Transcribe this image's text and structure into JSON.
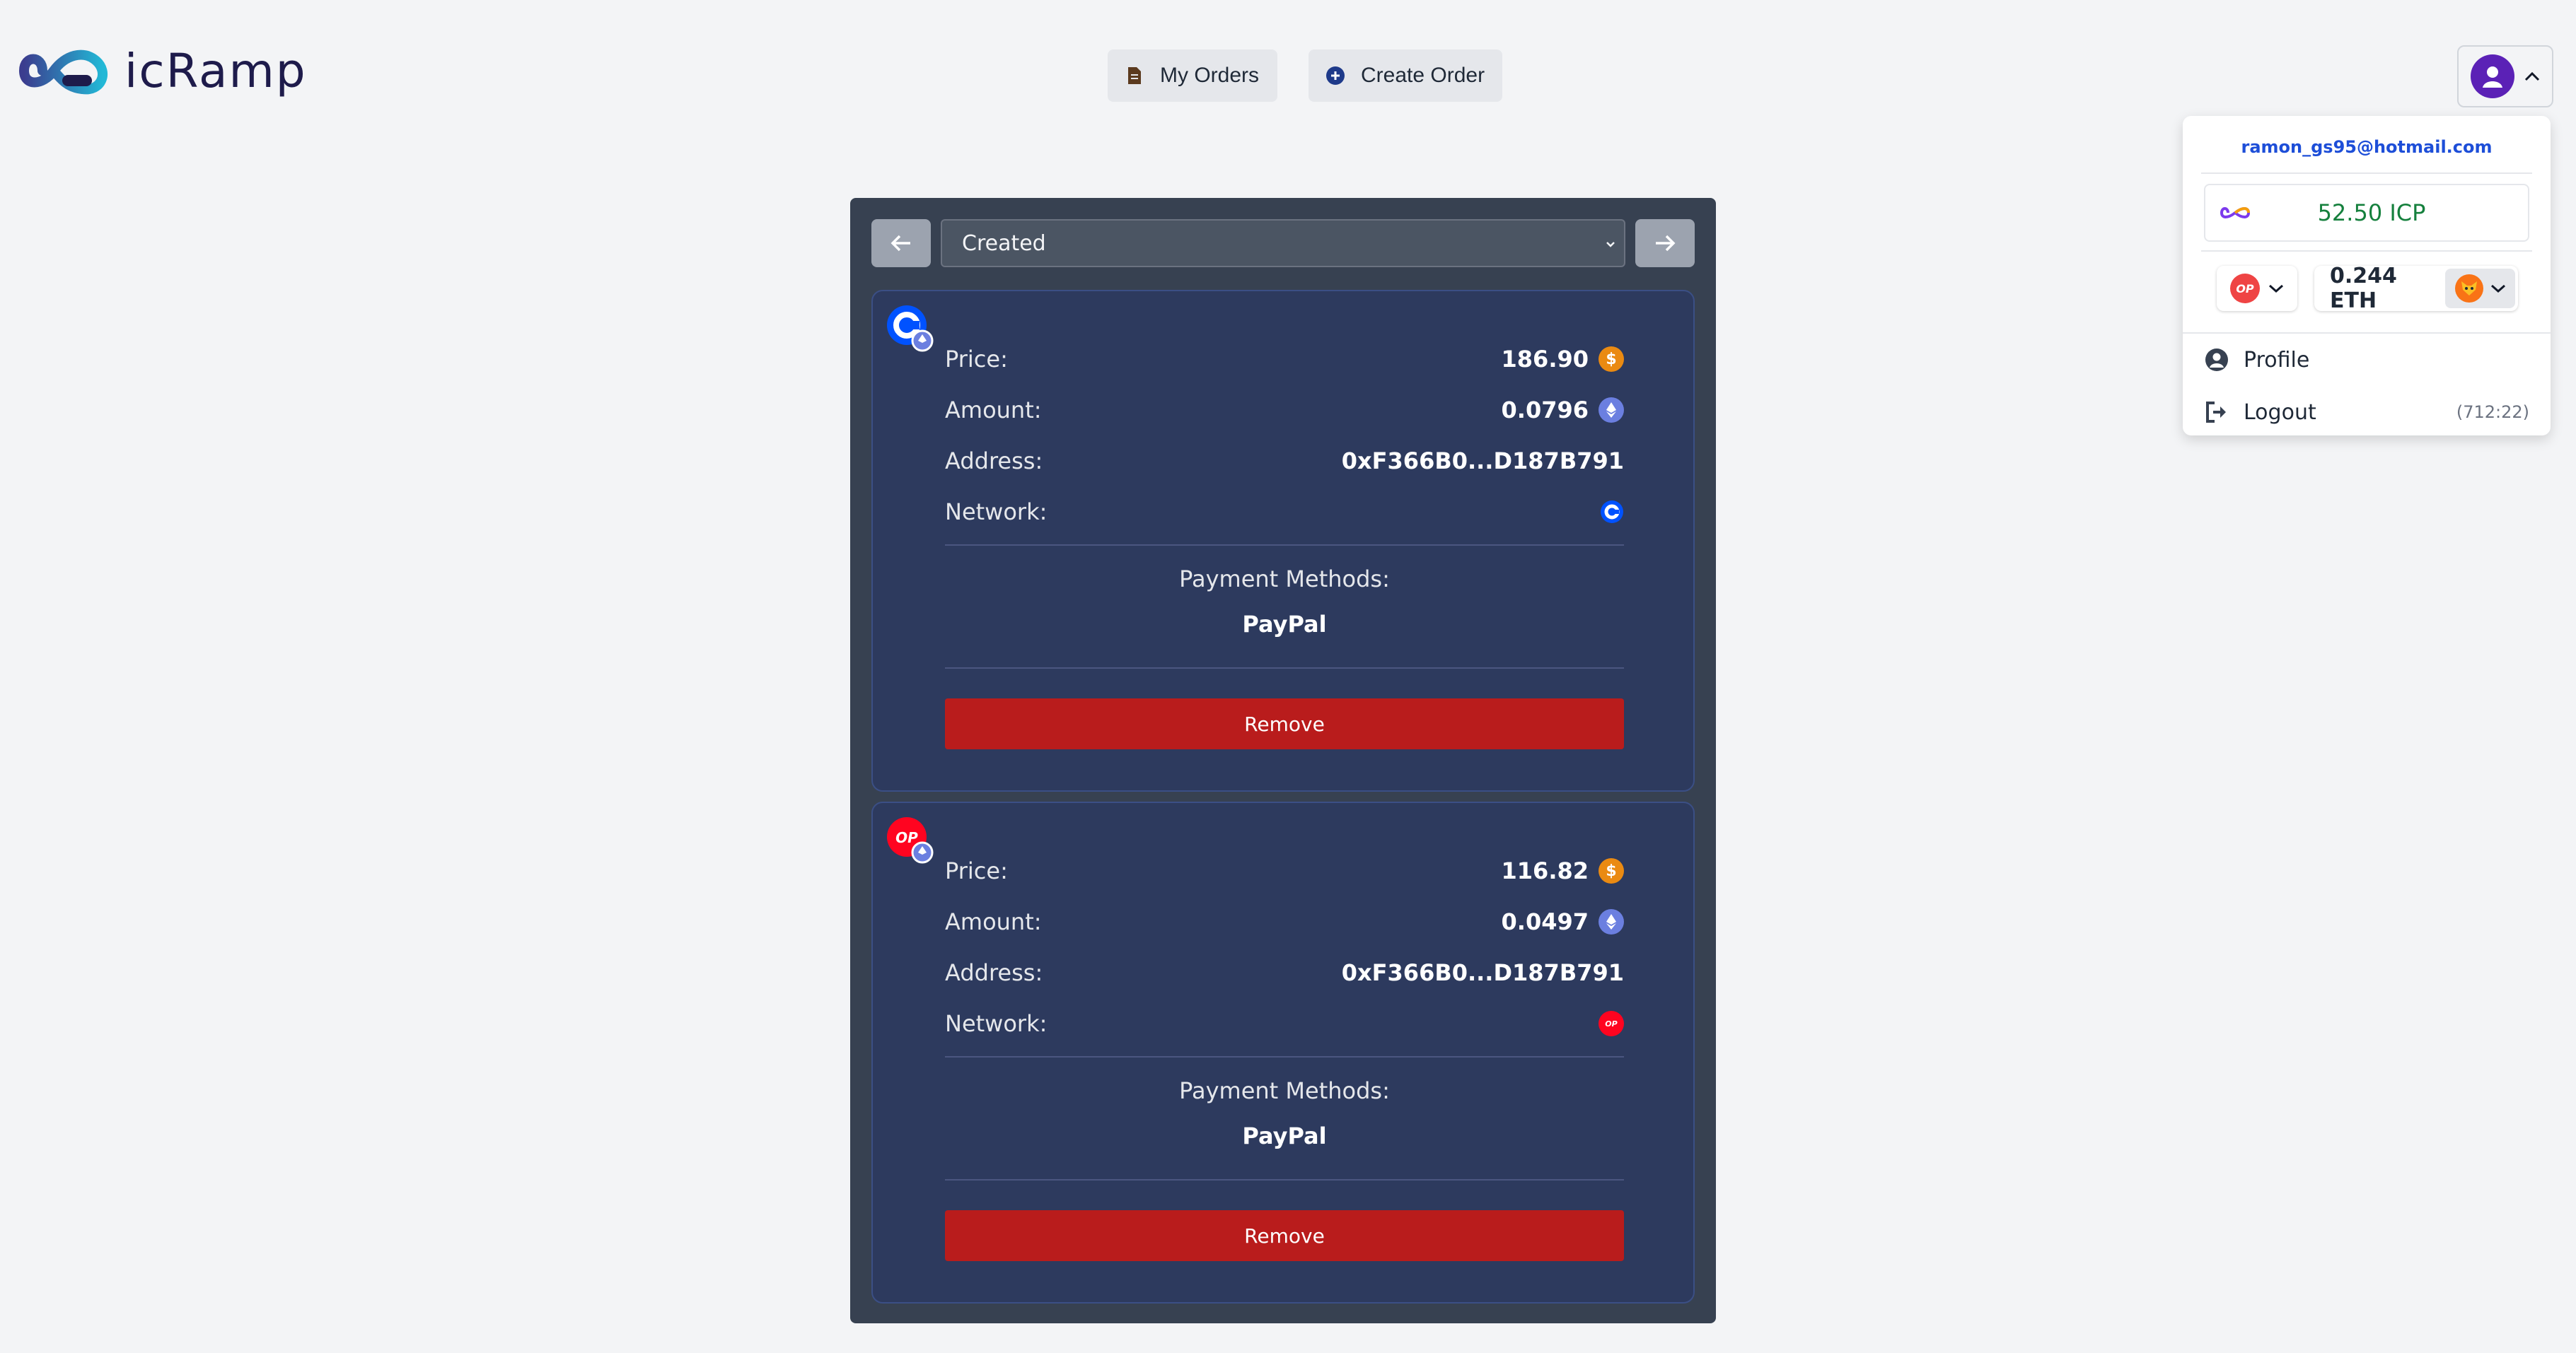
{
  "brand": {
    "name": "icRamp"
  },
  "nav": {
    "my_orders": "My Orders",
    "create_order": "Create Order"
  },
  "user_menu": {
    "email": "ramon_gs95@hotmail.com",
    "icp_balance": "52.50 ICP",
    "network_badge": "OP",
    "eth_balance": "0.244 ETH",
    "profile_label": "Profile",
    "logout_label": "Logout",
    "session_timer": "(712:22)"
  },
  "filter": {
    "selected_status": "Created"
  },
  "orders": [
    {
      "network_icon": "coinbase-base-icon",
      "price_label": "Price:",
      "price": "186.90",
      "amount_label": "Amount:",
      "amount": "0.0796",
      "address_label": "Address:",
      "address": "0xF366B0...D187B791",
      "network_label": "Network:",
      "payment_methods_label": "Payment Methods:",
      "payment_method": "PayPal",
      "remove_label": "Remove"
    },
    {
      "network_icon": "optimism-icon",
      "price_label": "Price:",
      "price": "116.82",
      "amount_label": "Amount:",
      "amount": "0.0497",
      "address_label": "Address:",
      "address": "0xF366B0...D187B791",
      "network_label": "Network:",
      "network_badge": "OP",
      "payment_methods_label": "Payment Methods:",
      "payment_method": "PayPal",
      "remove_label": "Remove"
    }
  ],
  "colors": {
    "panel": "#374151",
    "card": "#2d3a5e",
    "remove": "#b91c1c",
    "icp_green": "#15803d",
    "email_blue": "#1d4ed8"
  }
}
